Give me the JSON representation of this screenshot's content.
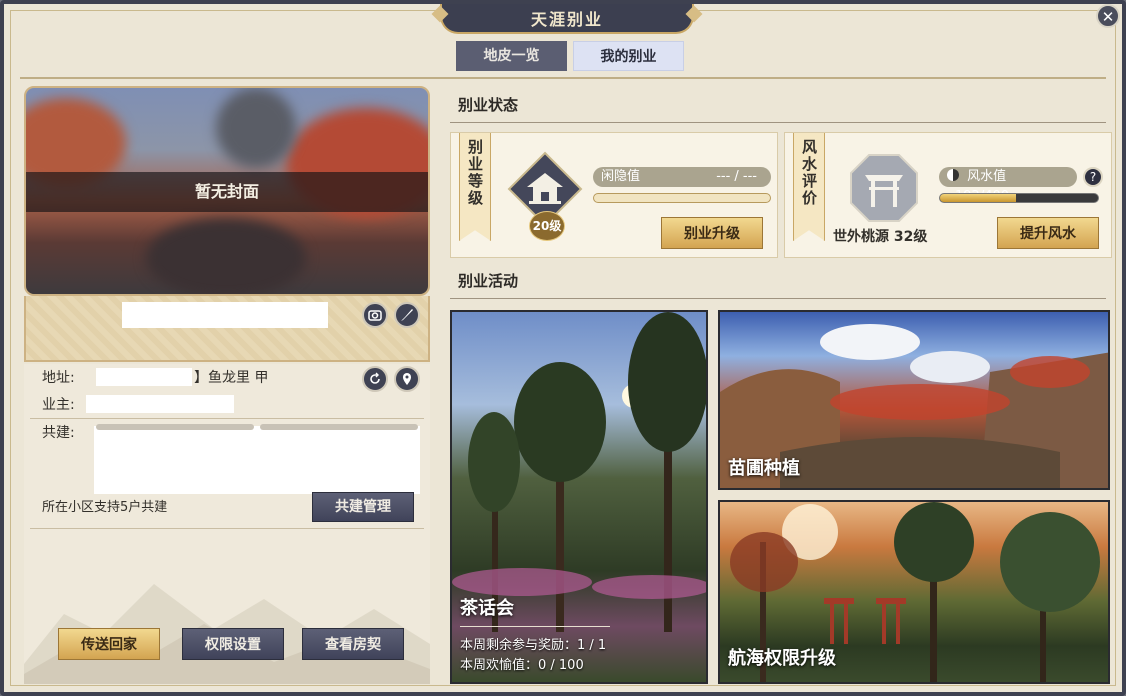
{
  "window": {
    "title": "天涯别业",
    "close_label": "✕"
  },
  "tabs": [
    {
      "label": "地皮一览",
      "active": false
    },
    {
      "label": "我的别业",
      "active": true
    }
  ],
  "left": {
    "cover_text": "暂无封面",
    "address_label": "地址:",
    "address_value": "】鱼龙里 甲",
    "owner_label": "业主:",
    "cobuild_label": "共建:",
    "cobuild_note": "所在小区支持5户共建",
    "cobuild_manage": "共建管理",
    "buttons": {
      "teleport": "传送回家",
      "permissions": "权限设置",
      "deed": "查看房契"
    }
  },
  "status": {
    "section_title": "别业状态",
    "level": {
      "ribbon": "别业等级",
      "badge": "20级",
      "idle_label": "闲隐值",
      "idle_value": "--- / ---",
      "idle_fill": 0,
      "upgrade": "别业升级"
    },
    "fengshui": {
      "ribbon": "风水评价",
      "name": "世外桃源 32级",
      "label": "风水值",
      "value": "192/400",
      "current": 192,
      "max": 400,
      "help": "?",
      "upgrade": "提升风水"
    }
  },
  "activity": {
    "section_title": "别业活动",
    "tea": {
      "title": "茶话会",
      "reward": "本周剩余参与奖励：1 / 1",
      "joy": "本周欢愉值：0 / 100"
    },
    "nursery": {
      "title": "苗圃种植"
    },
    "sailing": {
      "title": "航海权限升级"
    }
  },
  "colors": {
    "accent_gold": "#d3a451",
    "dark_btn": "#40435a",
    "frame": "#3e4150"
  },
  "icons": [
    "camera-icon",
    "brush-icon",
    "refresh-icon",
    "location-icon",
    "pavilion-icon",
    "gate-icon",
    "yin-yang-icon",
    "close-icon"
  ]
}
